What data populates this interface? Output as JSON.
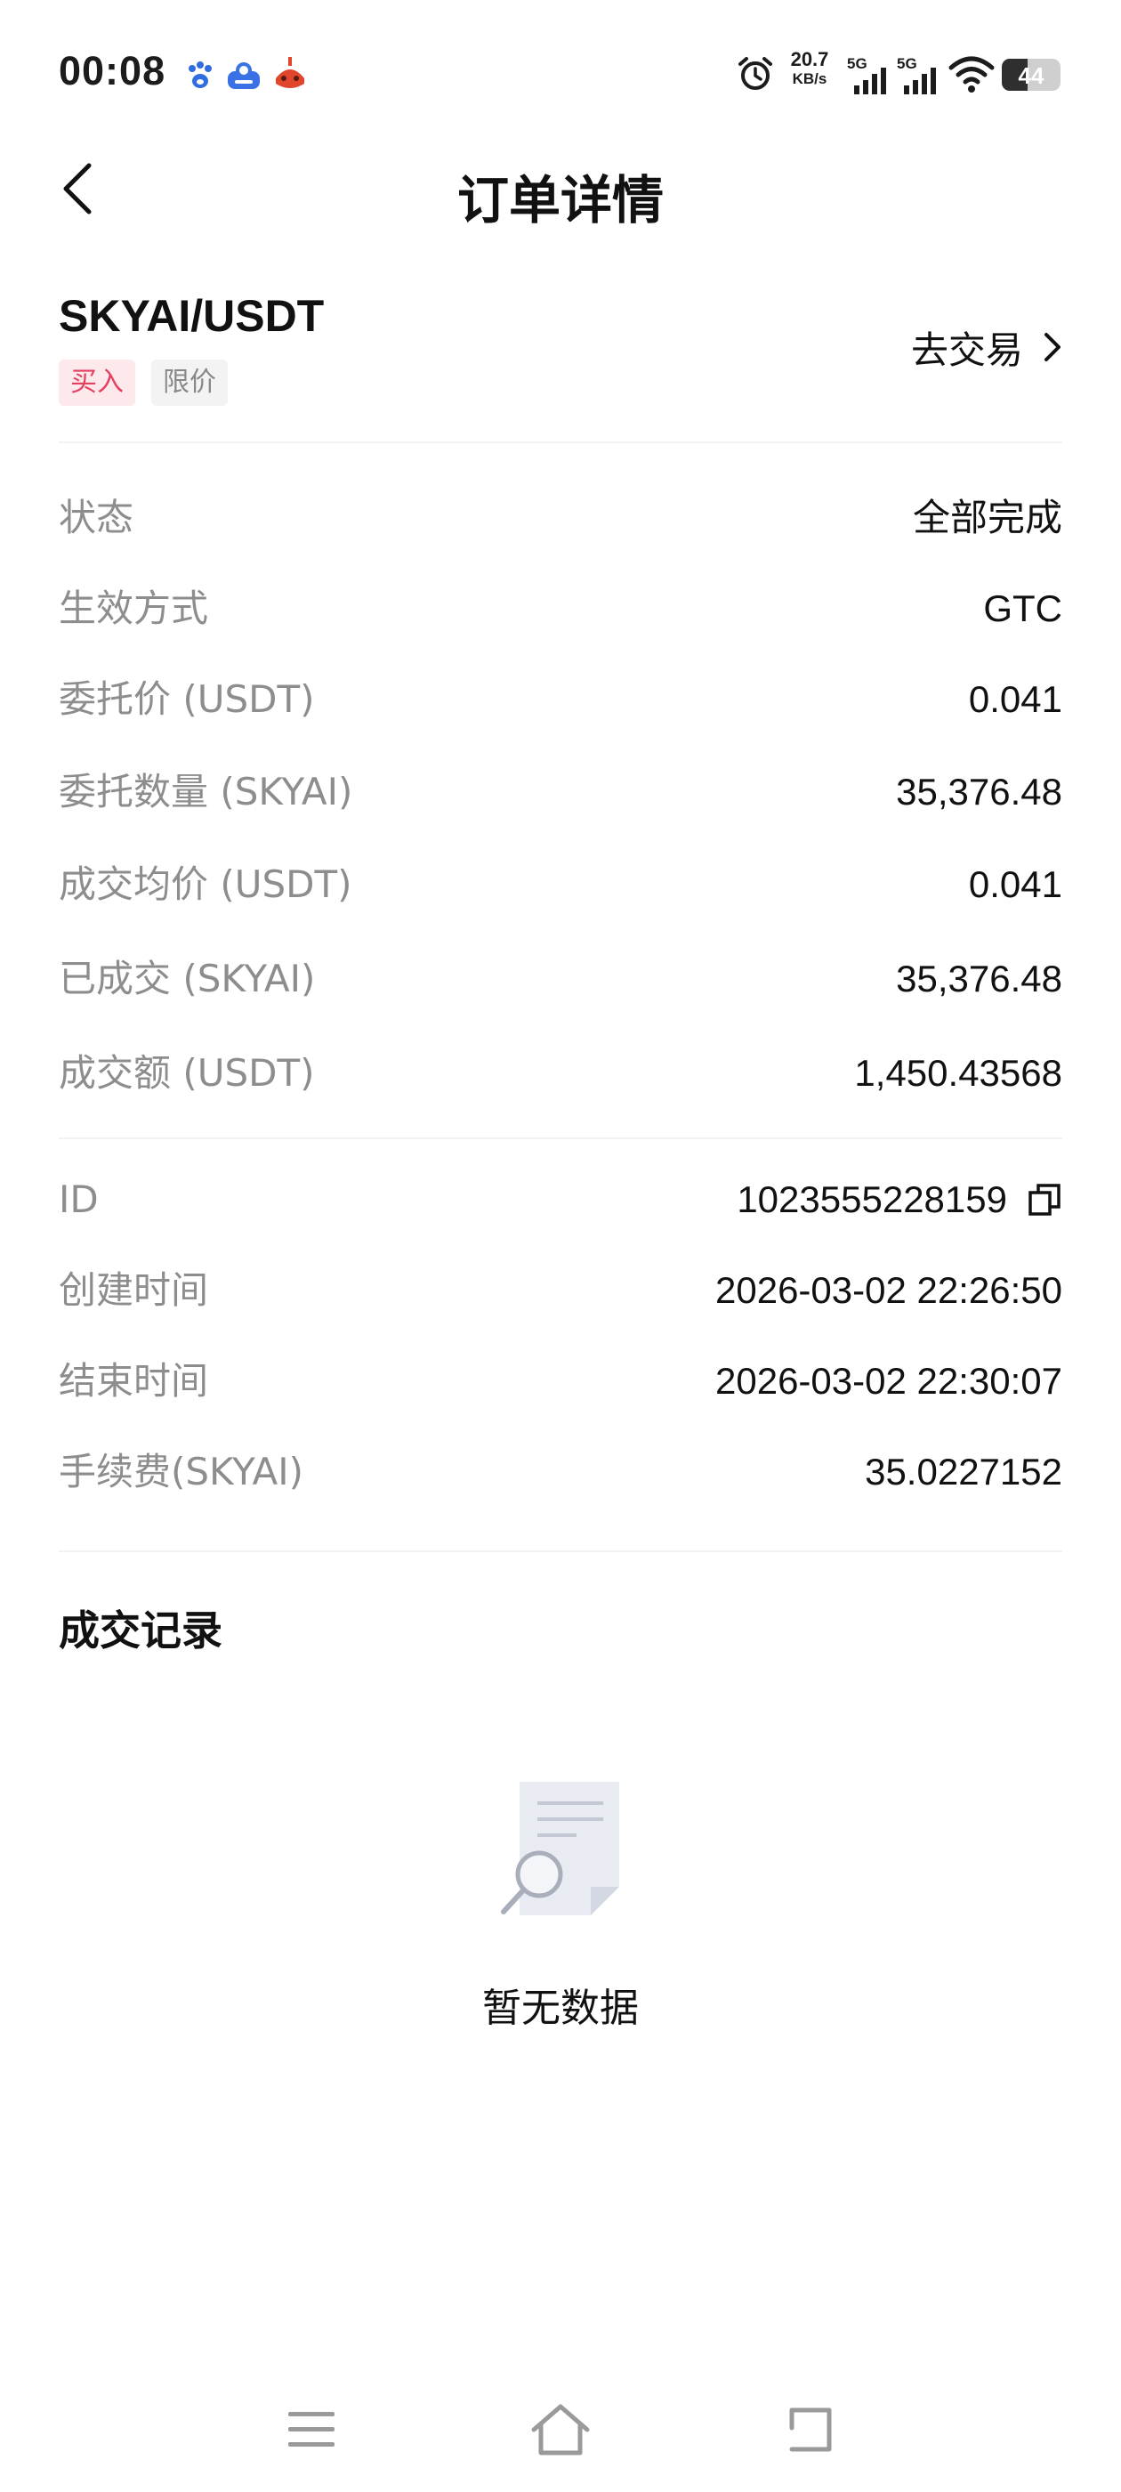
{
  "status_bar": {
    "time": "00:08",
    "net_speed_value": "20.7",
    "net_speed_unit": "KB/s",
    "signal_1": "5G",
    "signal_2": "5G",
    "battery_level": "44",
    "battery_fraction": 0.44,
    "app_icons": [
      "baidu-icon",
      "baidu-netdisk-icon",
      "red-app-icon"
    ]
  },
  "nav": {
    "title": "订单详情",
    "back_icon": "chevron-left-icon"
  },
  "order": {
    "pair": "SKYAI/USDT",
    "side_tag": "买入",
    "type_tag": "限价",
    "go_trade_label": "去交易",
    "details": [
      {
        "label": "状态",
        "value": "全部完成"
      },
      {
        "label": "生效方式",
        "value": "GTC"
      },
      {
        "label": "委托价 (USDT)",
        "value": "0.041"
      },
      {
        "label": "委托数量 (SKYAI)",
        "value": "35,376.48"
      },
      {
        "label": "成交均价 (USDT)",
        "value": "0.041"
      },
      {
        "label": "已成交 (SKYAI)",
        "value": "35,376.48"
      },
      {
        "label": "成交额 (USDT)",
        "value": "1,450.43568"
      }
    ],
    "meta": [
      {
        "label": "ID",
        "value": "1023555228159"
      },
      {
        "label": "创建时间",
        "value": "2026-03-02 22:26:50"
      },
      {
        "label": "结束时间",
        "value": "2026-03-02 22:30:07"
      },
      {
        "label": "手续费(SKYAI)",
        "value": "35.0227152"
      }
    ]
  },
  "trade_records": {
    "title": "成交记录",
    "empty_text": "暂无数据"
  },
  "colors": {
    "buy_tag_text": "#e54060",
    "buy_tag_bg": "#fde8ec",
    "label_gray": "#8d8d8d"
  }
}
